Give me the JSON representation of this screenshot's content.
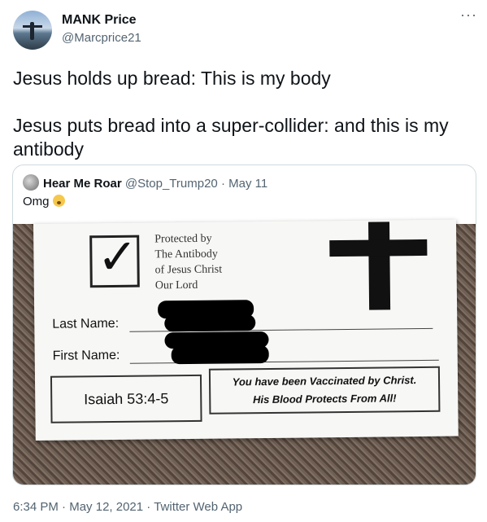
{
  "author": {
    "name": "MANK Price",
    "handle": "@Marcprice21"
  },
  "tweet": {
    "line1": "Jesus holds up bread: This is my body",
    "line2": "Jesus puts bread into a super-collider: and this is my antibody"
  },
  "quoted": {
    "name": "Hear Me Roar",
    "handle": "@Stop_Trump20",
    "separator": " · ",
    "date": "May 11",
    "text": "Omg",
    "emoji": "exploding-head-emoji"
  },
  "card": {
    "checkmark": "✓",
    "protected_lines": [
      "Protected by",
      "The Antibody",
      "of Jesus Christ",
      "Our Lord"
    ],
    "last_name_label": "Last Name:",
    "first_name_label": "First Name:",
    "verse": "Isaiah 53:4-5",
    "vaccinated_line1": "You have been Vaccinated by Christ.",
    "vaccinated_line2": "His Blood Protects From All!"
  },
  "footer": {
    "time": "6:34 PM",
    "date": "May 12, 2021",
    "source": "Twitter Web App",
    "separator": " · "
  },
  "more_label": "···"
}
